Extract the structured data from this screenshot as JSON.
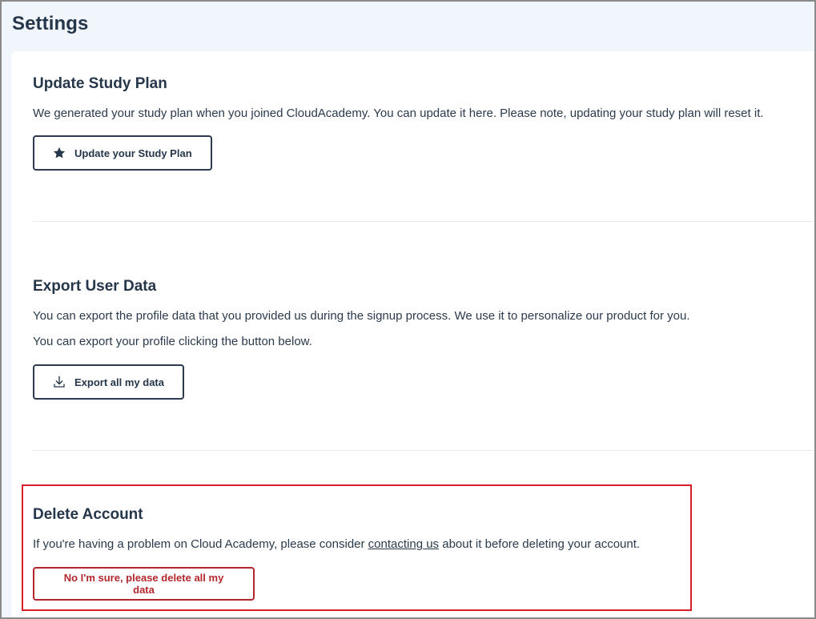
{
  "page": {
    "title": "Settings"
  },
  "study_plan": {
    "title": "Update Study Plan",
    "description": "We generated your study plan when you joined CloudAcademy. You can update it here. Please note, updating your study plan will reset it.",
    "button_label": "Update your Study Plan",
    "button_icon": "star-icon"
  },
  "export_data": {
    "title": "Export User Data",
    "description_1": "You can export the profile data that you provided us during the signup process. We use it to personalize our product for you.",
    "description_2": "You can export your profile clicking the button below.",
    "button_label": "Export all my data",
    "button_icon": "download-icon"
  },
  "delete_account": {
    "title": "Delete Account",
    "text_before": "If you're having a problem on Cloud Academy, please consider ",
    "link_label": "contacting us",
    "text_after": " about it before deleting your account.",
    "button_label": "No I'm sure, please delete all my data"
  },
  "colors": {
    "page_background": "#f1f6fc",
    "text_dark": "#26364a",
    "danger": "#b3262e",
    "highlight": "#d9202a"
  }
}
